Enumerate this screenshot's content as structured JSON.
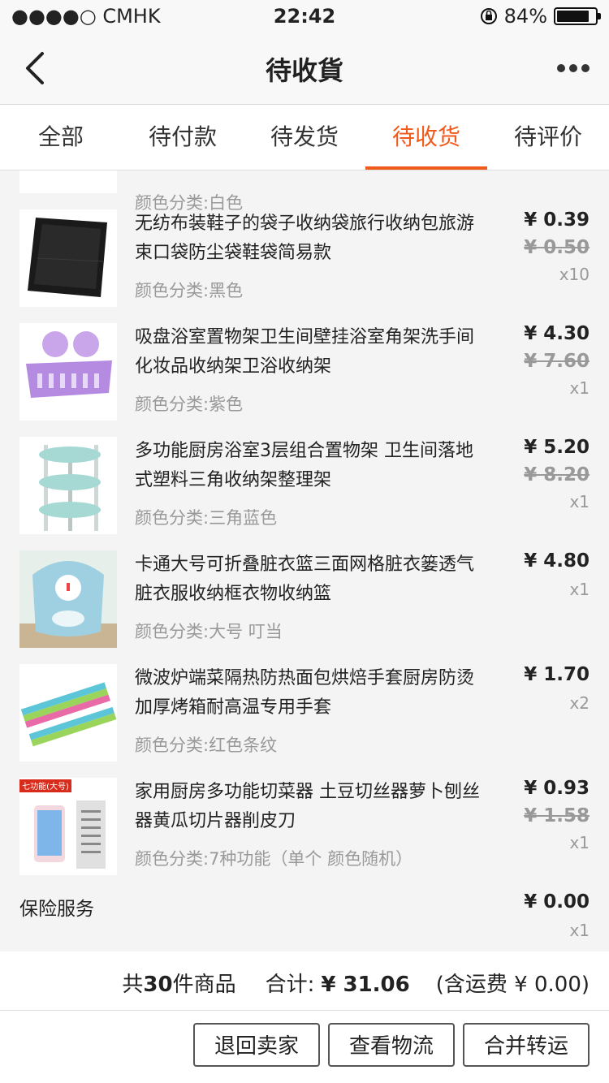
{
  "status_bar": {
    "carrier": "●●●●○ CMHK",
    "time": "22:42",
    "battery": "84%"
  },
  "nav": {
    "title": "待收貨"
  },
  "tabs": [
    {
      "label": "全部"
    },
    {
      "label": "待付款"
    },
    {
      "label": "待发货"
    },
    {
      "label": "待收货",
      "active": true
    },
    {
      "label": "待评价"
    }
  ],
  "items": [
    {
      "spec": "颜色分类:白色"
    },
    {
      "name": "无纺布装鞋子的袋子收纳袋旅行收纳包旅游束口袋防尘袋鞋袋简易款",
      "spec": "颜色分类:黑色",
      "price": "¥ 0.39",
      "orig": "¥ 0.50",
      "qty": "x10"
    },
    {
      "name": "吸盘浴室置物架卫生间壁挂浴室角架洗手间化妆品收纳架卫浴收纳架",
      "spec": "颜色分类:紫色",
      "price": "¥ 4.30",
      "orig": "¥ 7.60",
      "qty": "x1"
    },
    {
      "name": "多功能厨房浴室3层组合置物架 卫生间落地式塑料三角收纳架整理架",
      "spec": "颜色分类:三角蓝色",
      "price": "¥ 5.20",
      "orig": "¥ 8.20",
      "qty": "x1"
    },
    {
      "name": "卡通大号可折叠脏衣篮三面网格脏衣篓透气脏衣服收纳框衣物收纳篮",
      "spec": "颜色分类:大号 叮当",
      "price": "¥ 4.80",
      "qty": "x1"
    },
    {
      "name": "微波炉端菜隔热防热面包烘焙手套厨房防烫加厚烤箱耐高温专用手套",
      "spec": "颜色分类:红色条纹",
      "price": "¥ 1.70",
      "qty": "x2"
    },
    {
      "name": "家用厨房多功能切菜器 土豆切丝器萝卜刨丝器黄瓜切片器削皮刀",
      "spec": "颜色分类:7种功能（单个 颜色随机）",
      "price": "¥ 0.93",
      "orig": "¥ 1.58",
      "qty": "x1",
      "badge": "七功能(大号)"
    }
  ],
  "insurance": {
    "label": "保险服务",
    "price": "¥ 0.00",
    "qty": "x1"
  },
  "summary": {
    "count_prefix": "共",
    "count": "30",
    "count_suffix": "件商品",
    "total_label": "合计:",
    "total": "¥ 31.06",
    "shipping": "(含运费 ¥ 0.00)"
  },
  "buttons": {
    "return": "退回卖家",
    "logistics": "查看物流",
    "merge": "合并转运"
  },
  "colors": {
    "accent": "#f05a1a"
  }
}
